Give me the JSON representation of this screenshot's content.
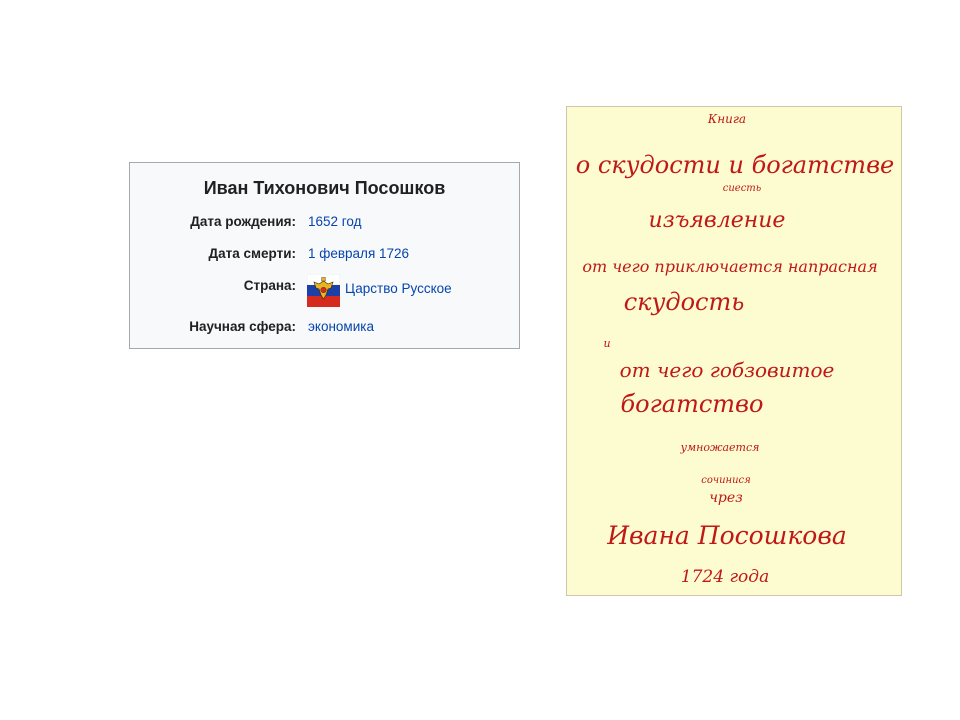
{
  "infobox": {
    "title": "Иван Тихонович Посошков",
    "rows": [
      {
        "label": "Дата рождения:",
        "value": "1652 год"
      },
      {
        "label": "Дата смерти:",
        "value": "1 февраля 1726"
      },
      {
        "label": "Страна:",
        "value": "Царство Русское",
        "flag_icon": "russian-tsardom-flag-icon"
      },
      {
        "label": "Научная сфера:",
        "value": "экономика"
      }
    ]
  },
  "manuscript": {
    "ink_color": "#c01818",
    "lines": [
      "Книга",
      "о скудости и богатстве",
      "сиесть",
      "изъявление",
      "от чего приключается напрасная",
      "скудость",
      "и",
      "от чего гобзовитое",
      "богатство",
      "умножается",
      "сочинися",
      "чрез",
      "Ивана Посошкова",
      "1724 года"
    ]
  },
  "colors": {
    "link": "#0645ad",
    "text": "#202122",
    "infobox_bg": "#f8f9fa",
    "infobox_border": "#a2a9b1",
    "paper": "#fdfbd0"
  }
}
